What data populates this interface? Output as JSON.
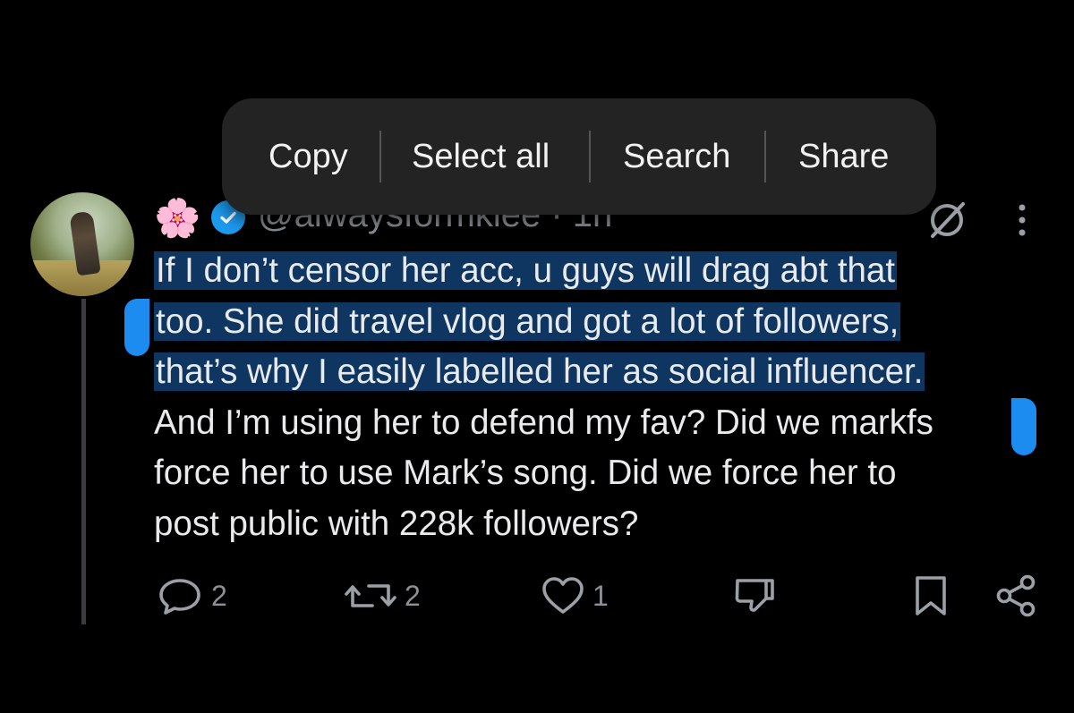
{
  "context_menu": {
    "items": [
      "Copy",
      "Select all",
      "Search",
      "Share"
    ]
  },
  "tweet": {
    "handle": "@alwaysformklee · 1h",
    "emoji": "🌸",
    "text_lines": [
      "If I don’t censor her acc, u guys will drag abt that",
      "too. She did travel vlog and got a lot of followers,",
      "that’s why I easily labelled her as social influencer.",
      "And I’m using her to defend my fav? Did we markfs",
      "force her to use Mark’s song. Did we force her to",
      "post public with 228k followers?"
    ],
    "selected_line_count": 3
  },
  "actions": {
    "replies": "2",
    "reposts": "2",
    "likes": "1"
  },
  "icons": {
    "reply": "reply-icon",
    "repost": "repost-icon",
    "like": "heart-icon",
    "dislike": "thumbs-down-icon",
    "bookmark": "bookmark-icon",
    "share": "share-icon",
    "grok": "grok-icon",
    "more": "more-vertical-icon",
    "verified": "verified-badge-icon"
  },
  "colors": {
    "background": "#000000",
    "selection": "#0e3660",
    "accent": "#1d9bf0",
    "menu": "#232323"
  }
}
